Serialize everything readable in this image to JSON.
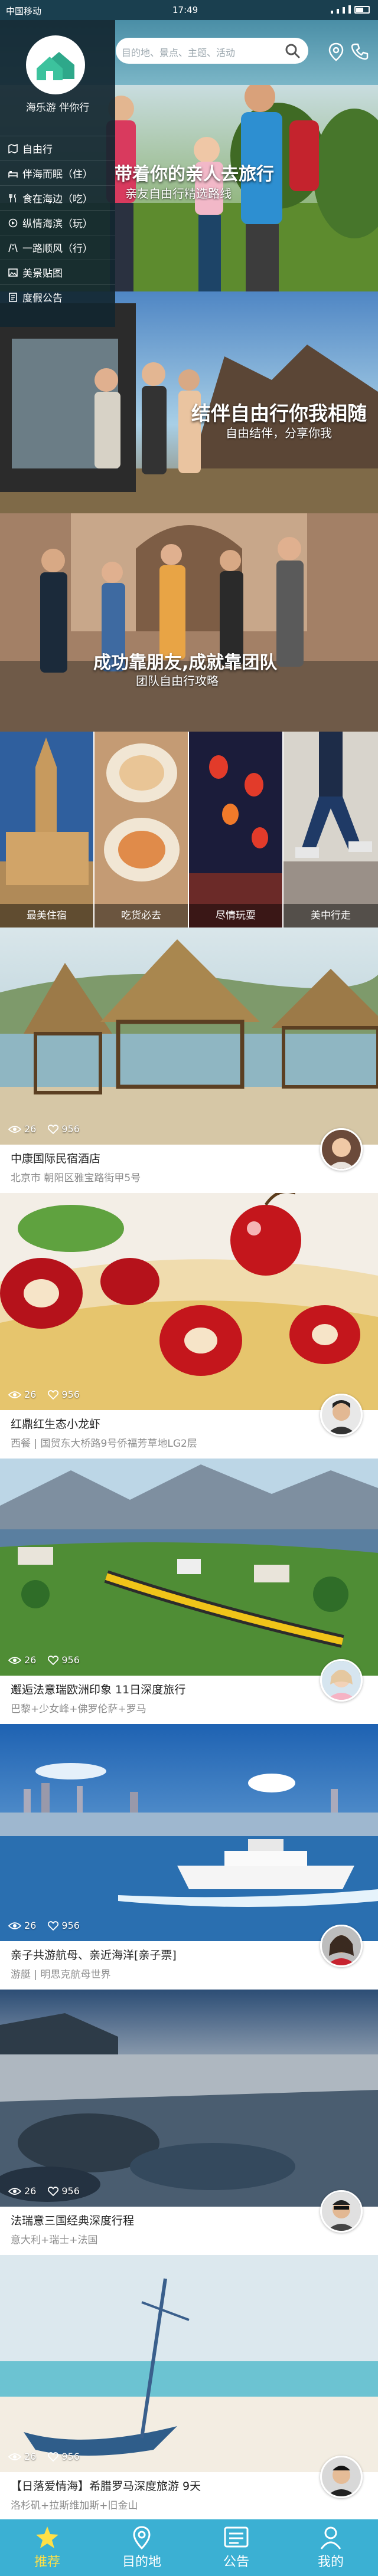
{
  "status_bar": {
    "carrier": "中国移动",
    "time": "17:49"
  },
  "header": {
    "search_placeholder": "目的地、景点、主题、活动"
  },
  "side_menu": {
    "logo_text": "海乐游 伴你行",
    "items": [
      {
        "label": "自由行",
        "icon": "map-icon"
      },
      {
        "label": "伴海而眠（住）",
        "icon": "bed-icon"
      },
      {
        "label": "食在海边（吃）",
        "icon": "food-icon"
      },
      {
        "label": "纵情海滨（玩）",
        "icon": "play-icon"
      },
      {
        "label": "一路顺风（行）",
        "icon": "road-icon"
      },
      {
        "label": "美景贴图",
        "icon": "image-icon"
      },
      {
        "label": "度假公告",
        "icon": "notice-icon"
      }
    ]
  },
  "banners": [
    {
      "headline": "带着你的亲人去旅行",
      "subline": "亲友自由行精选路线"
    },
    {
      "headline": "结伴自由行你我相随",
      "subline": "自由结伴，分享你我"
    },
    {
      "headline": "成功靠朋友,成就靠团队",
      "subline": "团队自由行攻略"
    }
  ],
  "categories": [
    {
      "label": "最美住宿"
    },
    {
      "label": "吃货必去"
    },
    {
      "label": "尽情玩耍"
    },
    {
      "label": "美中行走"
    }
  ],
  "feed": [
    {
      "views": "26",
      "likes": "956",
      "title": "中康国际民宿酒店",
      "subtitle": "北京市   朝阳区雅宝路街甲5号"
    },
    {
      "views": "26",
      "likes": "956",
      "title": "红鼎红生态小龙虾",
      "subtitle": "西餐 | 国贸东大桥路9号侨福芳草地LG2层"
    },
    {
      "views": "26",
      "likes": "956",
      "title": "邂逅法意瑞欧洲印象 11日深度旅行",
      "subtitle": "巴黎+少女峰+佛罗伦萨+罗马"
    },
    {
      "views": "26",
      "likes": "956",
      "title": "亲子共游航母、亲近海洋[亲子票]",
      "subtitle": "游艇 | 明思克航母世界"
    },
    {
      "views": "26",
      "likes": "956",
      "title": "法瑞意三国经典深度行程",
      "subtitle": "意大利+瑞士+法国"
    },
    {
      "views": "26",
      "likes": "956",
      "title": "【日落爱情海】希腊罗马深度旅游 9天",
      "subtitle": "洛杉矶+拉斯维加斯+旧金山"
    }
  ],
  "tab_bar": {
    "items": [
      {
        "label": "推荐",
        "active": true
      },
      {
        "label": "目的地",
        "active": false
      },
      {
        "label": "公告",
        "active": false
      },
      {
        "label": "我的",
        "active": false
      }
    ]
  },
  "colors": {
    "tab_bar": "#3bb0d3",
    "tab_active": "#ffe046",
    "status_bar": "#1a3f4f"
  }
}
